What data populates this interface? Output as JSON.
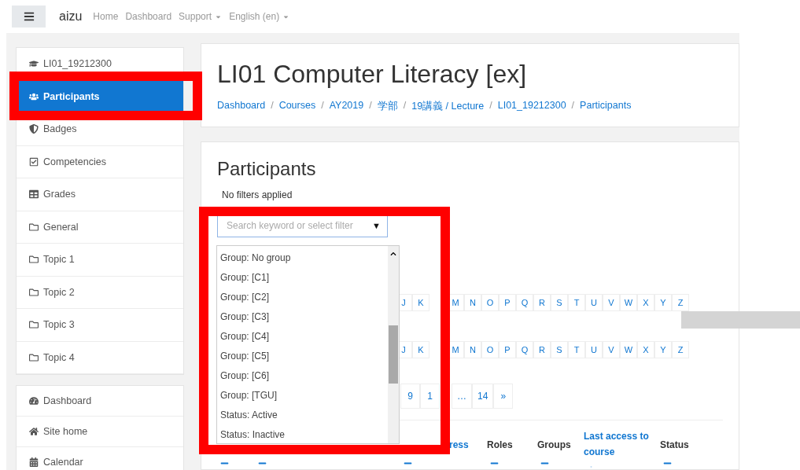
{
  "navbar": {
    "brand": "aizu",
    "links": [
      {
        "label": "Home",
        "dropdown": false
      },
      {
        "label": "Dashboard",
        "dropdown": false
      },
      {
        "label": "Support",
        "dropdown": true
      },
      {
        "label": "English (en)",
        "dropdown": true
      }
    ]
  },
  "sidebar": {
    "course_items": [
      {
        "label": "LI01_19212300",
        "kind": "course",
        "selected": false
      },
      {
        "label": "Participants",
        "kind": "participants",
        "selected": true
      },
      {
        "label": "Badges",
        "kind": "badges",
        "selected": false
      },
      {
        "label": "Competencies",
        "kind": "competencies",
        "selected": false
      },
      {
        "label": "Grades",
        "kind": "grades",
        "selected": false
      },
      {
        "label": "General",
        "kind": "section",
        "selected": false
      },
      {
        "label": "Topic 1",
        "kind": "section",
        "selected": false
      },
      {
        "label": "Topic 2",
        "kind": "section",
        "selected": false
      },
      {
        "label": "Topic 3",
        "kind": "section",
        "selected": false
      },
      {
        "label": "Topic 4",
        "kind": "section",
        "selected": false
      }
    ],
    "site_items": [
      {
        "label": "Dashboard",
        "kind": "dashboard",
        "selected": false
      },
      {
        "label": "Site home",
        "kind": "home",
        "selected": false
      },
      {
        "label": "Calendar",
        "kind": "calendar",
        "selected": false
      }
    ]
  },
  "header": {
    "title": "LI01 Computer Literacy [ex]",
    "breadcrumb": [
      {
        "label": "Dashboard"
      },
      {
        "separator": "/",
        "label": "Courses"
      },
      {
        "separator": "/",
        "label": "AY2019"
      },
      {
        "separator": "/",
        "label": "学部"
      },
      {
        "separator": "/",
        "label": "19講義 / Lecture"
      },
      {
        "separator": "/",
        "label": "LI01_19212300"
      },
      {
        "separator": "/",
        "label": "Participants"
      }
    ]
  },
  "participants": {
    "heading": "Participants",
    "filter_status": "No filters applied",
    "search": {
      "placeholder": "Search keyword or select filter",
      "caret": "▼"
    },
    "dropdown_options": [
      "Group: No group",
      "Group: [C1]",
      "Group: [C2]",
      "Group: [C3]",
      "Group: [C4]",
      "Group: [C5]",
      "Group: [C6]",
      "Group: [TGU]",
      "Status: Active",
      "Status: Inactive"
    ],
    "first_name_letters": [
      "J",
      "K",
      "M",
      "N",
      "O",
      "P",
      "Q",
      "R",
      "S",
      "T",
      "U",
      "V",
      "W",
      "X",
      "Y",
      "Z"
    ],
    "surname_letters": [
      "J",
      "K",
      "M",
      "N",
      "O",
      "P",
      "Q",
      "R",
      "S",
      "T",
      "U",
      "V",
      "W",
      "X",
      "Y",
      "Z"
    ],
    "pagination": [
      "9",
      "1",
      "…",
      "14",
      "»"
    ],
    "columns": [
      {
        "kind": "covered"
      },
      {
        "kind": "covered"
      },
      {
        "label": "ress",
        "kind": "link"
      },
      {
        "label": "Roles",
        "kind": "plain"
      },
      {
        "label": "Groups",
        "kind": "plain"
      },
      {
        "label": "Last access to course",
        "kind": "link"
      },
      {
        "label": "Status",
        "kind": "plain"
      }
    ]
  }
}
